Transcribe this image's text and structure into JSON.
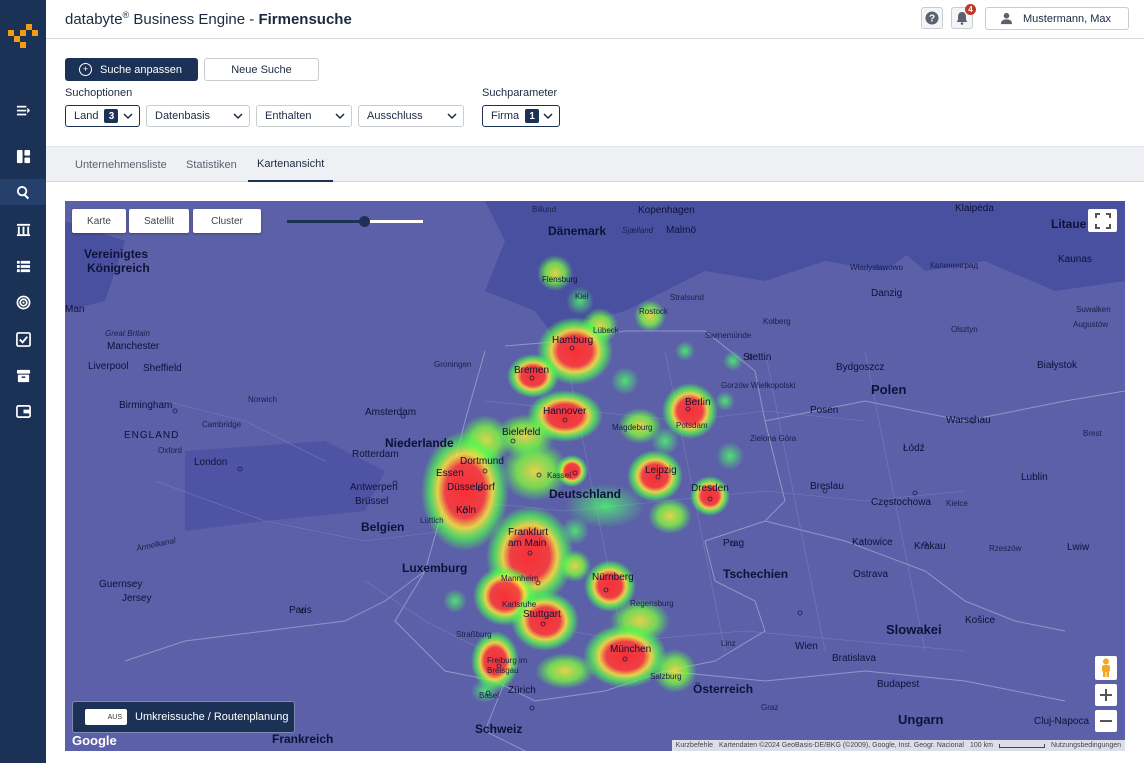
{
  "header": {
    "brand": "databyte",
    "brand_reg": "®",
    "product": " Business Engine - ",
    "page": "Firmensuche",
    "notification_count": "4",
    "user_name": "Mustermann, Max"
  },
  "sidebar": {
    "items": [
      {
        "icon": "menu-collapse-icon"
      },
      {
        "icon": "dashboard-icon"
      },
      {
        "icon": "search-icon",
        "active": true
      },
      {
        "icon": "building-icon"
      },
      {
        "icon": "list-icon"
      },
      {
        "icon": "target-icon"
      },
      {
        "icon": "checklist-icon"
      },
      {
        "icon": "archive-icon"
      },
      {
        "icon": "export-icon"
      }
    ]
  },
  "actions": {
    "adjust_search": "Suche anpassen",
    "new_search": "Neue Suche"
  },
  "search_options": {
    "label": "Suchoptionen",
    "land": "Land",
    "land_count": "3",
    "datenbasis": "Datenbasis",
    "enthalten": "Enthalten",
    "ausschluss": "Ausschluss"
  },
  "search_params": {
    "label": "Suchparameter",
    "firma": "Firma",
    "firma_count": "1"
  },
  "tabs": [
    "Unternehmensliste",
    "Statistiken",
    "Kartenansicht"
  ],
  "active_tab": "Kartenansicht",
  "map": {
    "controls": {
      "karte": "Karte",
      "satellit": "Satellit",
      "cluster": "Cluster"
    },
    "heatmap_opacity": 0.57,
    "route_toggle_state": "AUS",
    "route_label": "Umkreissuche / Routenplanung",
    "google": "Google",
    "attribution": {
      "shortcuts": "Kurzbefehle",
      "data": "Kartendaten ©2024 GeoBasis-DE/BKG (©2009), Google, Inst. Geogr. Nacional",
      "scale": "100 km",
      "terms": "Nutzungsbedingungen"
    },
    "labels": {
      "daenemark": "Dänemark",
      "deutschland": "Deutschland",
      "niederlande": "Niederlande",
      "belgien": "Belgien",
      "luxemburg": "Luxemburg",
      "frankreich": "Frankreich",
      "schweiz": "Schweiz",
      "oesterreich": "Österreich",
      "tschechien": "Tschechien",
      "polen": "Polen",
      "slowakei": "Slowakei",
      "ungarn": "Ungarn",
      "litauen": "Litaue",
      "vk1": "Vereinigtes",
      "vk2": "Königreich",
      "england": "ENGLAND",
      "hamburg": "Hamburg",
      "bremen": "Bremen",
      "hannover": "Hannover",
      "berlin": "Berlin",
      "potsdam": "Potsdam",
      "bielefeld": "Bielefeld",
      "dortmund": "Dortmund",
      "essen": "Essen",
      "duesseldorf": "Düsseldorf",
      "koeln": "Köln",
      "leipzig": "Leipzig",
      "dresden": "Dresden",
      "kassel": "Kassel",
      "magdeburg": "Magdeburg",
      "frankfurt1": "Frankfurt",
      "frankfurt2": "am Main",
      "mannheim": "Mannheim",
      "nuernberg": "Nürnberg",
      "karlsruhe": "Karlsruhe",
      "stuttgart": "Stuttgart",
      "regensburg": "Regensburg",
      "muenchen": "München",
      "freiburg1": "Freiburg im",
      "freiburg2": "Breisgau",
      "zuerich": "Zürich",
      "basel": "Basel",
      "strassburg": "Straßburg",
      "salzburg": "Salzburg",
      "flensburg": "Flensburg",
      "kiel": "Kiel",
      "luebeck": "Lübeck",
      "rostock": "Rostock",
      "stralsund": "Stralsund",
      "groningen": "Groningen",
      "amsterdam": "Amsterdam",
      "rotterdam": "Rotterdam",
      "antwerpen": "Antwerpen",
      "bruessel": "Brüssel",
      "luettich": "Lüttich",
      "paris": "Paris",
      "london": "London",
      "birmingham": "Birmingham",
      "manchester": "Manchester",
      "liverpool": "Liverpool",
      "sheffield": "Sheffield",
      "norwich": "Norwich",
      "cambridge": "Cambridge",
      "oxford": "Oxford",
      "great_britain": "Great Britain",
      "man": "Man",
      "guernsey": "Guernsey",
      "jersey": "Jersey",
      "kopenhagen": "Kopenhagen",
      "malmoe": "Malmö",
      "sjaelland": "Sjælland",
      "billund": "Billund",
      "klaipeda": "Klaipėda",
      "kaunas": "Kaunas",
      "danzig": "Danzig",
      "kolberg": "Kolberg",
      "stettin": "Stettin",
      "posen": "Posen",
      "warschau": "Warschau",
      "lodz": "Łódź",
      "bydgoszcz": "Bydgoszcz",
      "olsztyn": "Olsztyn",
      "bialystok": "Białystok",
      "breslau": "Breslau",
      "czestochowa": "Częstochowa",
      "kielce": "Kielce",
      "lublin": "Lublin",
      "katowice": "Katowice",
      "krakau": "Krakau",
      "rzeszow": "Rzeszów",
      "lwiw": "Lwiw",
      "prag": "Prag",
      "ostrava": "Ostrava",
      "bratislava": "Bratislava",
      "wien": "Wien",
      "budapest": "Budapest",
      "kosice": "Košice",
      "linz": "Linz",
      "graz": "Graz",
      "cluj": "Cluj-Napoca",
      "brest": "Brest",
      "suwalken": "Suwalken",
      "augustow": "Augustów",
      "wladyslawowo": "Władysławowo",
      "kaliningrad": "Калининград",
      "swinemuende": "Swinemünde",
      "gorzow": "Gorzów Wielkopolski",
      "zielona": "Zielona Góra",
      "aermelkanal": "Ärmelkanal",
      "luxemburg_city": "Lüttich"
    }
  }
}
